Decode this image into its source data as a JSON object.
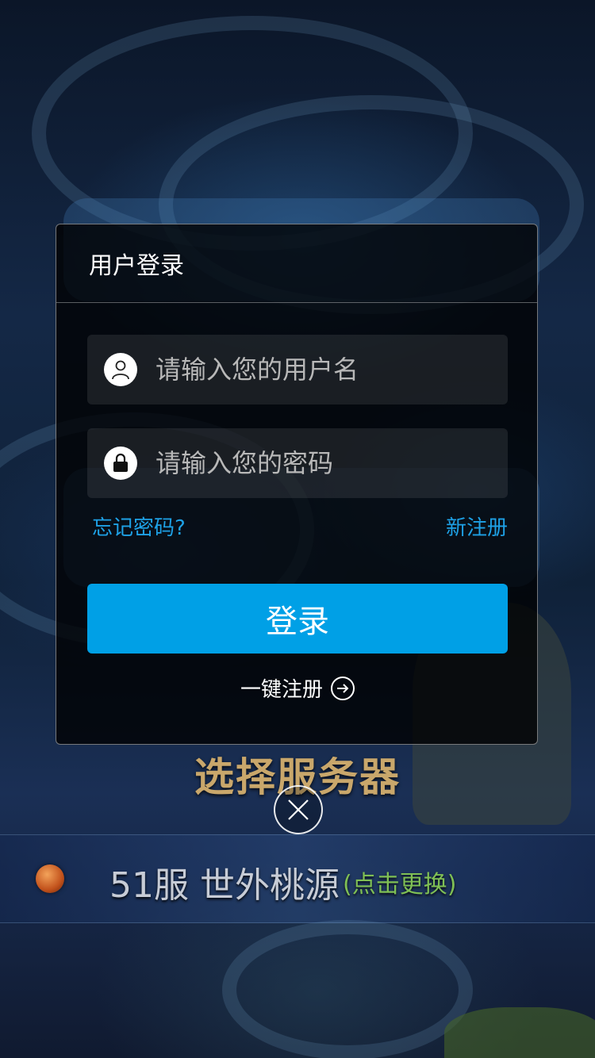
{
  "dialog": {
    "title": "用户登录",
    "username_placeholder": "请输入您的用户名",
    "password_placeholder": "请输入您的密码",
    "forgot_password": "忘记密码?",
    "new_register": "新注册",
    "login_button": "登录",
    "quick_register": "一键注册"
  },
  "server": {
    "section_title": "选择服务器",
    "current": "51服 世外桃源",
    "change_label": "(点击更换)"
  },
  "icons": {
    "username": "user-icon",
    "password": "lock-icon",
    "quick_register": "arrow-circle-right-icon",
    "close": "close-icon"
  },
  "colors": {
    "accent": "#00a0e6",
    "link": "#1ea1e6",
    "server_title": "#c9a76b",
    "server_change": "#7fbf55"
  }
}
